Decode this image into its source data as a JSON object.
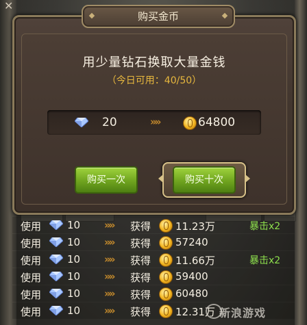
{
  "dialog": {
    "title": "购买金币",
    "close_glyph": "✕",
    "headline": "用少量钻石换取大量金钱",
    "subline": "（今日可用：40/50）"
  },
  "exchange": {
    "diamond_amount": "20",
    "arrow": "»»",
    "gold_amount": "64800"
  },
  "buttons": {
    "buy_once": "购买一次",
    "buy_ten": "购买十次"
  },
  "log": {
    "use_label": "使用",
    "get_label": "获得",
    "arrow": "»»",
    "rows": [
      {
        "cost": "10",
        "gain": "11.23万",
        "crit": "暴击x2"
      },
      {
        "cost": "10",
        "gain": "57240",
        "crit": ""
      },
      {
        "cost": "10",
        "gain": "11.66万",
        "crit": "暴击x2"
      },
      {
        "cost": "10",
        "gain": "59400",
        "crit": ""
      },
      {
        "cost": "10",
        "gain": "60480",
        "crit": ""
      },
      {
        "cost": "10",
        "gain": "12.31万",
        "crit": ""
      }
    ]
  },
  "watermark": "新浪游戏",
  "colors": {
    "accent_gold": "#e7b73e",
    "crit_green": "#8ee04d",
    "button_green": "#6fa41f",
    "diamond": "#a9c8ff"
  },
  "icons": [
    "diamond-icon",
    "gold-coin-icon",
    "double-chevron-icon",
    "close-icon"
  ]
}
